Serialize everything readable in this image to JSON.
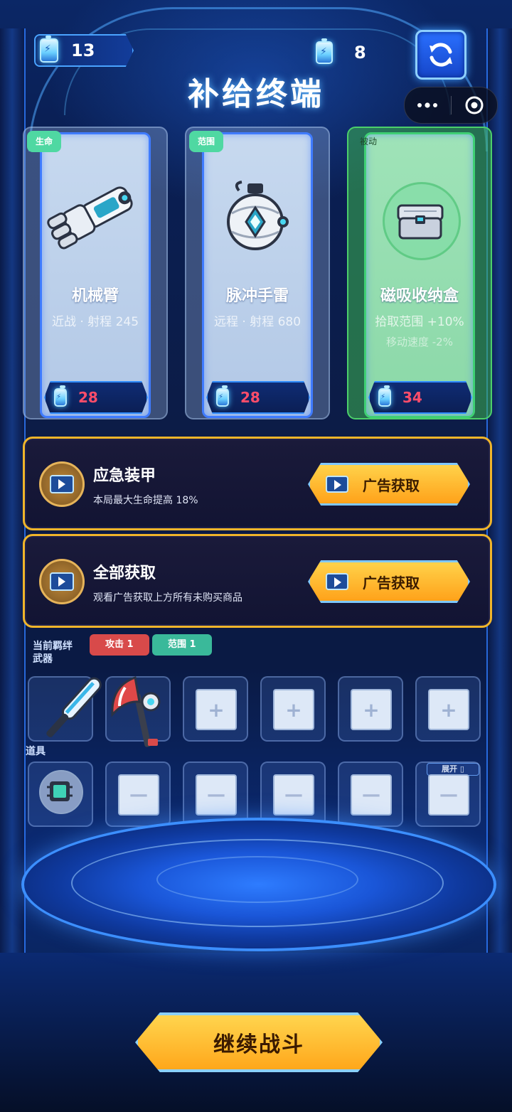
{
  "resources": {
    "energy_left": "13",
    "energy_right": "8"
  },
  "title": "补给终端",
  "cards": [
    {
      "tag": "生命",
      "name": "机械臂",
      "stat": "近战 · 射程 245",
      "stat2": "",
      "price": "28"
    },
    {
      "tag": "范围",
      "name": "脉冲手雷",
      "stat": "远程 · 射程 680",
      "stat2": "",
      "price": "28"
    },
    {
      "tag": "被动",
      "name": "磁吸收纳盒",
      "stat": "拾取范围 +10%",
      "stat2": "移动速度 -2%",
      "price": "34"
    }
  ],
  "offers": [
    {
      "title": "应急装甲",
      "desc": "本局最大生命提高 18%",
      "button": "广告获取"
    },
    {
      "title": "全部获取",
      "desc": "观看广告获取上方所有未购买商品",
      "button": "广告获取"
    }
  ],
  "bond": {
    "label_line1": "当前羁绊",
    "label_line2": "武器",
    "badges": [
      "攻击 1",
      "范围 1"
    ]
  },
  "weapon_slots": [
    "baseball-bat",
    "battle-axe",
    "+",
    "+",
    "+",
    "+"
  ],
  "items_label": "道具",
  "item_slots": [
    "chip",
    "—",
    "—",
    "—",
    "—",
    "—"
  ],
  "expand_label": "展开 ▯",
  "continue_label": "继续战斗",
  "colors": {
    "accent_blue": "#3f7bff",
    "price_red": "#ff4d6a",
    "gold": "#f0b52a",
    "passive_green": "#4cd06a"
  }
}
